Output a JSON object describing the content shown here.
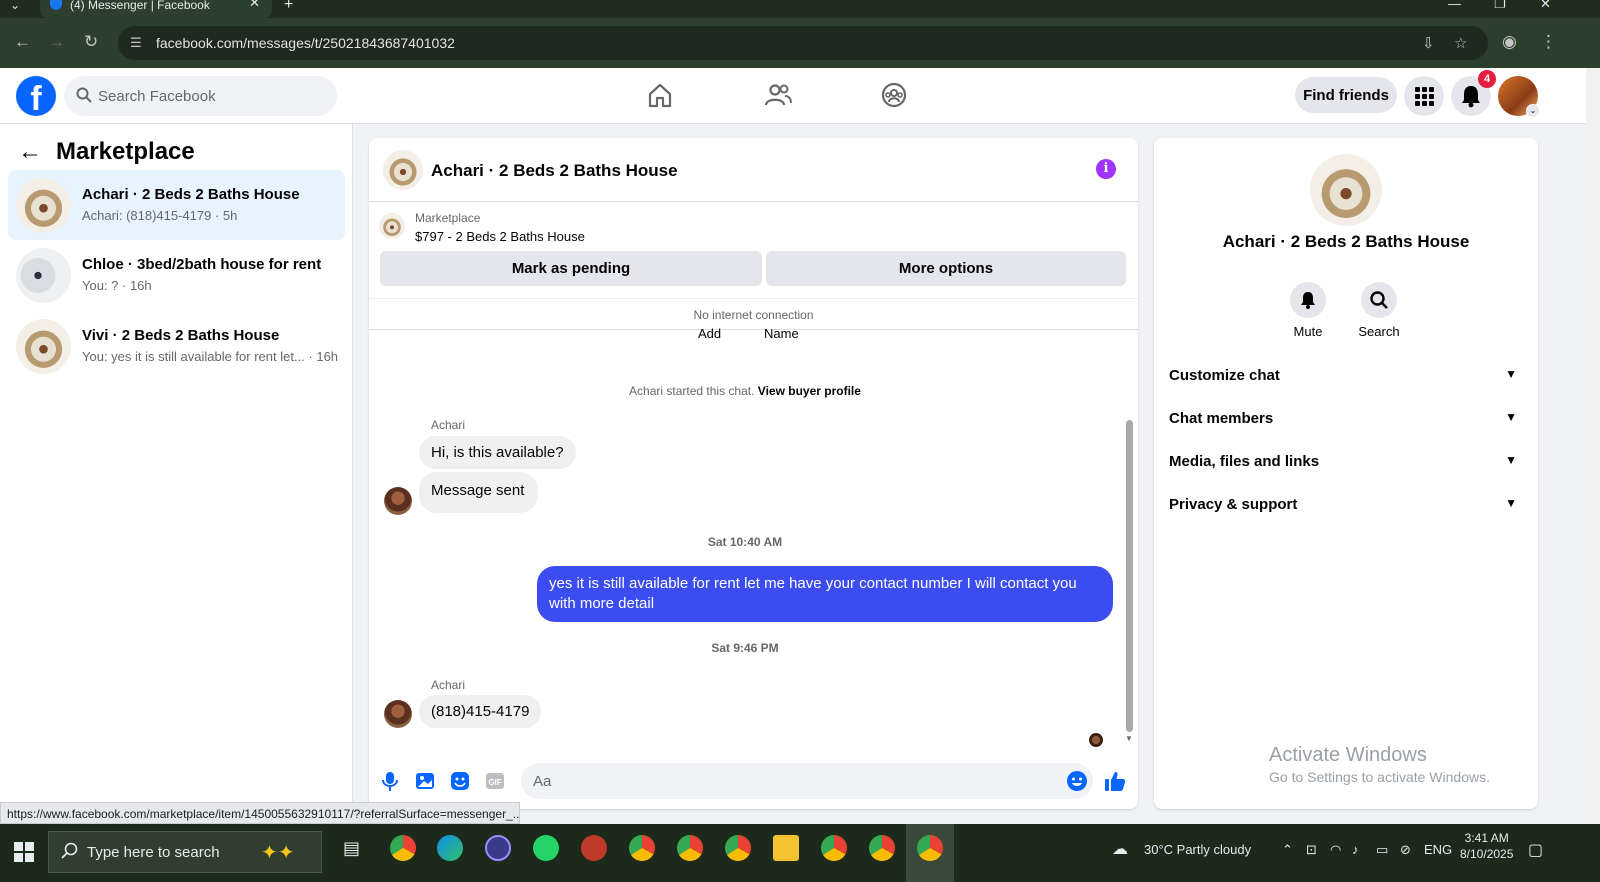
{
  "browser": {
    "tab_title": "(4) Messenger | Facebook",
    "url": "facebook.com/messages/t/25021843687401032"
  },
  "header": {
    "logo": "f",
    "search_placeholder": "Search Facebook",
    "find_friends": "Find friends",
    "notification_count": "4"
  },
  "left": {
    "title": "Marketplace",
    "chats": [
      {
        "name": "Achari · 2 Beds 2 Baths House",
        "preview": "Achari: (818)415-4179 · 5h"
      },
      {
        "name": "Chloe · 3bed/2bath house for rent",
        "preview": "You: ? · 16h"
      },
      {
        "name": "Vivi · 2 Beds 2 Baths House",
        "preview": "You: yes it is still available for rent let... · 16h"
      }
    ]
  },
  "chat": {
    "title": "Achari · 2 Beds 2 Baths House",
    "marketplace_label": "Marketplace",
    "listing": "$797 - 2 Beds 2 Baths House",
    "mark_pending": "Mark as pending",
    "more_options": "More options",
    "no_connection": "No internet connection",
    "cut_add": "Add",
    "cut_name": "Name",
    "started": "Achari started this chat.",
    "view_profile": "View buyer profile",
    "sender": "Achari",
    "msg1": "Hi, is this available?",
    "msg2": "Message sent",
    "time1": "Sat 10:40 AM",
    "msg_me": "yes it is still available for rent let me have your contact number I will contact you with more detail",
    "time2": "Sat 9:46 PM",
    "msg3": "(818)415-4179",
    "composer_placeholder": "Aa"
  },
  "right": {
    "title": "Achari · 2 Beds 2 Baths House",
    "mute": "Mute",
    "search": "Search",
    "rows": [
      "Customize chat",
      "Chat members",
      "Media, files and links",
      "Privacy & support"
    ],
    "activate_title": "Activate Windows",
    "activate_sub": "Go to Settings to activate Windows."
  },
  "status_url": "https://www.facebook.com/marketplace/item/1450055632910117/?referralSurface=messenger_...",
  "taskbar": {
    "search": "Type here to search",
    "weather": "30°C  Partly cloudy",
    "lang": "ENG",
    "time": "3:41 AM",
    "date": "8/10/2025"
  },
  "colors": {
    "accent": "#0866ff",
    "my_bubble": "#3b4cf0",
    "info": "#a033ff",
    "badge": "#e41e3f"
  }
}
